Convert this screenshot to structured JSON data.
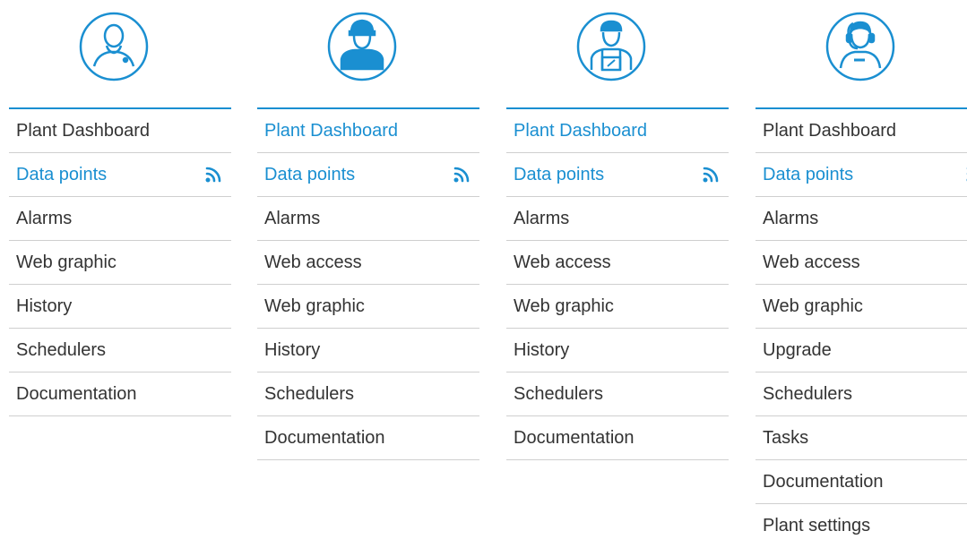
{
  "accent_color": "#1a8fd1",
  "columns": [
    {
      "avatar_icon": "user-icon",
      "items": [
        {
          "label": "Plant Dashboard",
          "active": false
        },
        {
          "label": "Data points",
          "active": true,
          "icon": "rss-icon"
        },
        {
          "label": "Alarms",
          "active": false
        },
        {
          "label": "Web graphic",
          "active": false
        },
        {
          "label": "History",
          "active": false
        },
        {
          "label": "Schedulers",
          "active": false
        },
        {
          "label": "Documentation",
          "active": false
        }
      ]
    },
    {
      "avatar_icon": "hard-hat-worker-icon",
      "items": [
        {
          "label": "Plant Dashboard",
          "active": true
        },
        {
          "label": "Data points",
          "active": true,
          "icon": "rss-icon"
        },
        {
          "label": "Alarms",
          "active": false
        },
        {
          "label": "Web access",
          "active": false
        },
        {
          "label": "Web graphic",
          "active": false
        },
        {
          "label": "History",
          "active": false
        },
        {
          "label": "Schedulers",
          "active": false
        },
        {
          "label": "Documentation",
          "active": false
        }
      ]
    },
    {
      "avatar_icon": "technician-icon",
      "items": [
        {
          "label": "Plant Dashboard",
          "active": true
        },
        {
          "label": "Data points",
          "active": true,
          "icon": "rss-icon"
        },
        {
          "label": "Alarms",
          "active": false
        },
        {
          "label": "Web access",
          "active": false
        },
        {
          "label": "Web graphic",
          "active": false
        },
        {
          "label": "History",
          "active": false
        },
        {
          "label": "Schedulers",
          "active": false
        },
        {
          "label": "Documentation",
          "active": false
        }
      ]
    },
    {
      "avatar_icon": "support-headset-icon",
      "items": [
        {
          "label": "Plant Dashboard",
          "active": false
        },
        {
          "label": "Data points",
          "active": true,
          "icon": "rss-icon"
        },
        {
          "label": "Alarms",
          "active": false
        },
        {
          "label": "Web access",
          "active": false
        },
        {
          "label": "Web graphic",
          "active": false
        },
        {
          "label": "Upgrade",
          "active": false
        },
        {
          "label": "Schedulers",
          "active": false
        },
        {
          "label": "Tasks",
          "active": false
        },
        {
          "label": "Documentation",
          "active": false
        },
        {
          "label": "Plant settings",
          "active": false
        }
      ]
    }
  ]
}
